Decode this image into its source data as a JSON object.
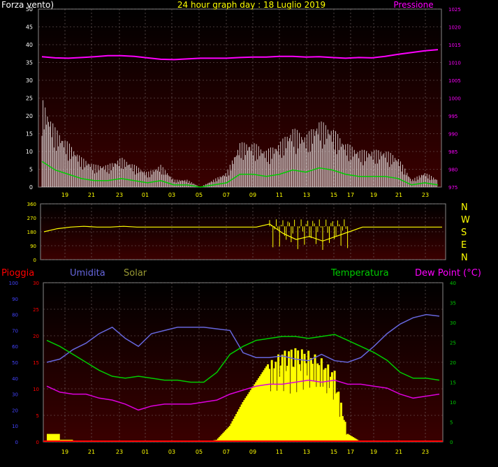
{
  "header": {
    "left_title": "Forza vento)",
    "center_title": "24 hour graph day : 18 Luglio 2019",
    "right_title": "Pressione"
  },
  "wind_panel": {
    "left_ticks": [
      "0",
      "5",
      "10",
      "15",
      "20",
      "25",
      "30",
      "35",
      "40",
      "45",
      "50"
    ],
    "right_ticks": [
      "975",
      "980",
      "985",
      "990",
      "995",
      "1000",
      "1005",
      "1010",
      "1015",
      "1020",
      "1025"
    ],
    "x_ticks": [
      "19",
      "21",
      "23",
      "01",
      "03",
      "05",
      "07",
      "09",
      "11",
      "13",
      "15",
      "17",
      "19",
      "21",
      "23"
    ]
  },
  "direction_panel": {
    "left_ticks": [
      "0",
      "90",
      "180",
      "270",
      "360"
    ],
    "compass": [
      "N",
      "W",
      "S",
      "E",
      "N"
    ],
    "x_ticks": [
      "19",
      "21",
      "23",
      "01",
      "03",
      "05",
      "07",
      "09",
      "11",
      "13",
      "15",
      "17",
      "19",
      "21",
      "23"
    ]
  },
  "weather_panel": {
    "legend": {
      "rain": "Pioggia",
      "humidity": "Umidita",
      "solar": "Solar",
      "temperature": "Temperatura",
      "dewpoint": "Dew Point (°C)"
    },
    "humidity_ticks": [
      "0",
      "10",
      "20",
      "30",
      "40",
      "50",
      "60",
      "70",
      "80",
      "90",
      "100"
    ],
    "rain_ticks": [
      "0",
      "5",
      "10",
      "15",
      "20",
      "25",
      "30"
    ],
    "temp_ticks": [
      "0",
      "5",
      "10",
      "15",
      "20",
      "25",
      "30",
      "35",
      "40"
    ],
    "x_ticks": [
      "19",
      "21",
      "23",
      "01",
      "03",
      "05",
      "07",
      "09",
      "11",
      "13",
      "15",
      "17",
      "19",
      "21",
      "23"
    ]
  },
  "colors": {
    "background_top": "#000000",
    "background_bottom": "#3a0000",
    "grid": "#7a6a6a",
    "axis_text": "#ffff00",
    "title_text": "#ffff00",
    "left_title_text": "#ffffff",
    "pressure": "#ff00ff",
    "wind_gust": "#ffffff",
    "wind_avg": "#00cc00",
    "direction": "#ffff00",
    "rain": "#ff0000",
    "humidity": "#6666dd",
    "solar": "#ffff00",
    "solar_label": "#999933",
    "temperature": "#00cc00",
    "dewpoint": "#dd00dd",
    "left_axis_humidity": "#4444ff",
    "right_axis_temp": "#00cc00"
  },
  "chart_data": [
    {
      "type": "line",
      "title": "24 hour graph day : 18 Luglio 2019",
      "x": [
        "18",
        "19",
        "20",
        "21",
        "22",
        "23",
        "00",
        "01",
        "02",
        "03",
        "04",
        "05",
        "06",
        "07",
        "08",
        "09",
        "10",
        "11",
        "12",
        "13",
        "14",
        "15",
        "16",
        "17",
        "18",
        "19",
        "20",
        "21",
        "22",
        "23",
        "24"
      ],
      "series": [
        {
          "name": "Pressione",
          "values": [
            1011.6,
            1011.3,
            1011.2,
            1011.4,
            1011.6,
            1011.9,
            1011.9,
            1011.7,
            1011.3,
            1010.9,
            1010.8,
            1011.0,
            1011.2,
            1011.2,
            1011.2,
            1011.4,
            1011.5,
            1011.5,
            1011.7,
            1011.7,
            1011.5,
            1011.6,
            1011.4,
            1011.2,
            1011.4,
            1011.3,
            1011.7,
            1012.3,
            1012.8,
            1013.3,
            1013.6
          ]
        },
        {
          "name": "Forza vento)",
          "values": [
            12,
            8,
            6,
            4,
            3,
            3,
            4,
            3,
            2,
            3,
            1,
            1,
            0,
            1,
            2,
            6,
            6,
            5,
            6,
            8,
            7,
            9,
            8,
            6,
            5,
            5,
            5,
            4,
            1,
            2,
            1
          ]
        }
      ],
      "y_left_label": "Forza vento)",
      "y_right_label": "Pressione",
      "ylim_left": [
        0,
        50
      ],
      "ylim_right": [
        975,
        1025
      ]
    },
    {
      "type": "line",
      "x": [
        "18",
        "19",
        "20",
        "21",
        "22",
        "23",
        "00",
        "01",
        "02",
        "03",
        "04",
        "05",
        "06",
        "07",
        "08",
        "09",
        "10",
        "11",
        "12",
        "13",
        "14",
        "15",
        "16",
        "17",
        "18",
        "19",
        "20",
        "21",
        "22",
        "23",
        "24"
      ],
      "series": [
        {
          "name": "direction",
          "values": [
            180,
            200,
            210,
            215,
            210,
            210,
            215,
            210,
            210,
            210,
            210,
            210,
            210,
            210,
            210,
            210,
            210,
            230,
            170,
            130,
            150,
            120,
            150,
            180,
            210,
            210,
            210,
            210,
            210,
            210,
            210
          ]
        }
      ],
      "ylim": [
        0,
        360
      ]
    },
    {
      "type": "area",
      "x": [
        "18",
        "19",
        "20",
        "21",
        "22",
        "23",
        "00",
        "01",
        "02",
        "03",
        "04",
        "05",
        "06",
        "07",
        "08",
        "09",
        "10",
        "11",
        "12",
        "13",
        "14",
        "15",
        "16",
        "17",
        "18",
        "19",
        "20",
        "21",
        "22",
        "23",
        "24"
      ],
      "series": [
        {
          "name": "Umidita",
          "axis": "left_humidity",
          "values": [
            50,
            52,
            58,
            62,
            68,
            72,
            65,
            60,
            68,
            70,
            72,
            72,
            72,
            71,
            70,
            56,
            53,
            53,
            54,
            52,
            51,
            55,
            51,
            50,
            53,
            60,
            68,
            74,
            78,
            80,
            79
          ]
        },
        {
          "name": "Temperatura",
          "axis": "right_temp",
          "values": [
            25.5,
            24.0,
            22.0,
            20.0,
            18.0,
            16.5,
            16.0,
            16.5,
            16.0,
            15.5,
            15.5,
            15.0,
            15.0,
            17.5,
            22.0,
            24.0,
            25.5,
            26.0,
            26.5,
            26.5,
            26.0,
            26.5,
            27.0,
            25.5,
            24.0,
            22.5,
            20.5,
            17.5,
            16.0,
            16.0,
            15.5
          ]
        },
        {
          "name": "Dew Point (°C)",
          "axis": "right_temp",
          "values": [
            14.0,
            12.5,
            12.0,
            12.0,
            11.0,
            10.5,
            9.5,
            8.0,
            9.0,
            9.5,
            9.5,
            9.5,
            10.0,
            10.5,
            12.0,
            13.0,
            14.0,
            14.5,
            14.5,
            15.0,
            15.5,
            15.0,
            15.5,
            14.5,
            14.5,
            14.0,
            13.5,
            12.0,
            11.0,
            11.5,
            12.0
          ]
        },
        {
          "name": "Solar",
          "axis": "right_temp",
          "values": [
            0,
            0,
            0,
            0,
            0,
            0,
            0,
            0,
            0,
            0,
            0,
            0,
            0,
            0.5,
            4,
            10,
            15,
            20,
            23,
            24,
            23,
            21,
            18,
            2,
            0,
            0,
            0,
            0,
            0,
            0,
            0
          ]
        },
        {
          "name": "Pioggia",
          "axis": "rain",
          "values": [
            1.5,
            0.4,
            0.1,
            0,
            0,
            0,
            0,
            0,
            0,
            0,
            0,
            0,
            0,
            0,
            0,
            0,
            0,
            0,
            0,
            0,
            0,
            0,
            0,
            0,
            0,
            0,
            0,
            0,
            0,
            0,
            0
          ]
        }
      ],
      "ylim_humidity": [
        0,
        100
      ],
      "ylim_rain": [
        0,
        30
      ],
      "ylim_temp": [
        0,
        40
      ]
    }
  ]
}
